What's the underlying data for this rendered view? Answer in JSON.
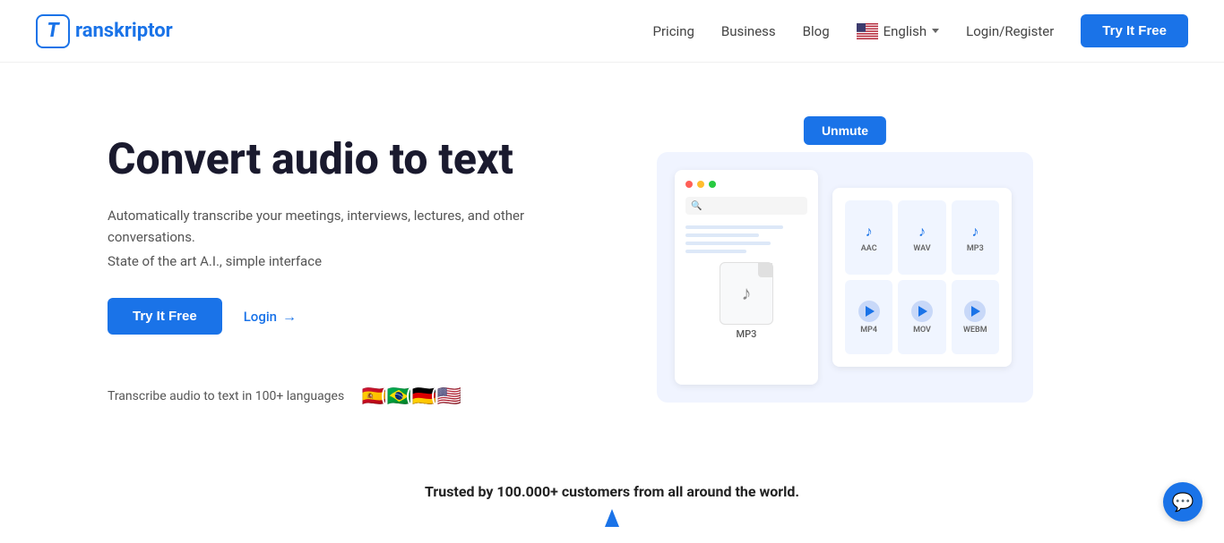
{
  "header": {
    "logo_text": "ranskriptor",
    "logo_letter": "T",
    "nav": {
      "pricing": "Pricing",
      "business": "Business",
      "blog": "Blog",
      "language": "English",
      "login_register": "Login/Register",
      "try_free": "Try It Free"
    }
  },
  "hero": {
    "title": "Convert audio to text",
    "description1": "Automatically transcribe your meetings, interviews, lectures, and other conversations.",
    "description2": "State of the art A.I., simple interface",
    "btn_try": "Try It Free",
    "btn_login": "Login",
    "unmute_btn": "Unmute",
    "languages_label": "Transcribe audio to text in 100+ languages",
    "flags": [
      "🇪🇸",
      "🇧🇷",
      "🇩🇪",
      "🇺🇸"
    ]
  },
  "file_browser": {
    "filename": "MP3",
    "music_note": "♪"
  },
  "formats": [
    {
      "label": "AAC",
      "type": "music"
    },
    {
      "label": "WAV",
      "type": "music"
    },
    {
      "label": "MP3",
      "type": "music"
    },
    {
      "label": "MP4",
      "type": "video"
    },
    {
      "label": "MOV",
      "type": "video"
    },
    {
      "label": "WEBM",
      "type": "video"
    }
  ],
  "bottom": {
    "trusted_text": "Trusted by 100.000+ customers from all around the world."
  },
  "chat": {
    "icon": "💬"
  }
}
